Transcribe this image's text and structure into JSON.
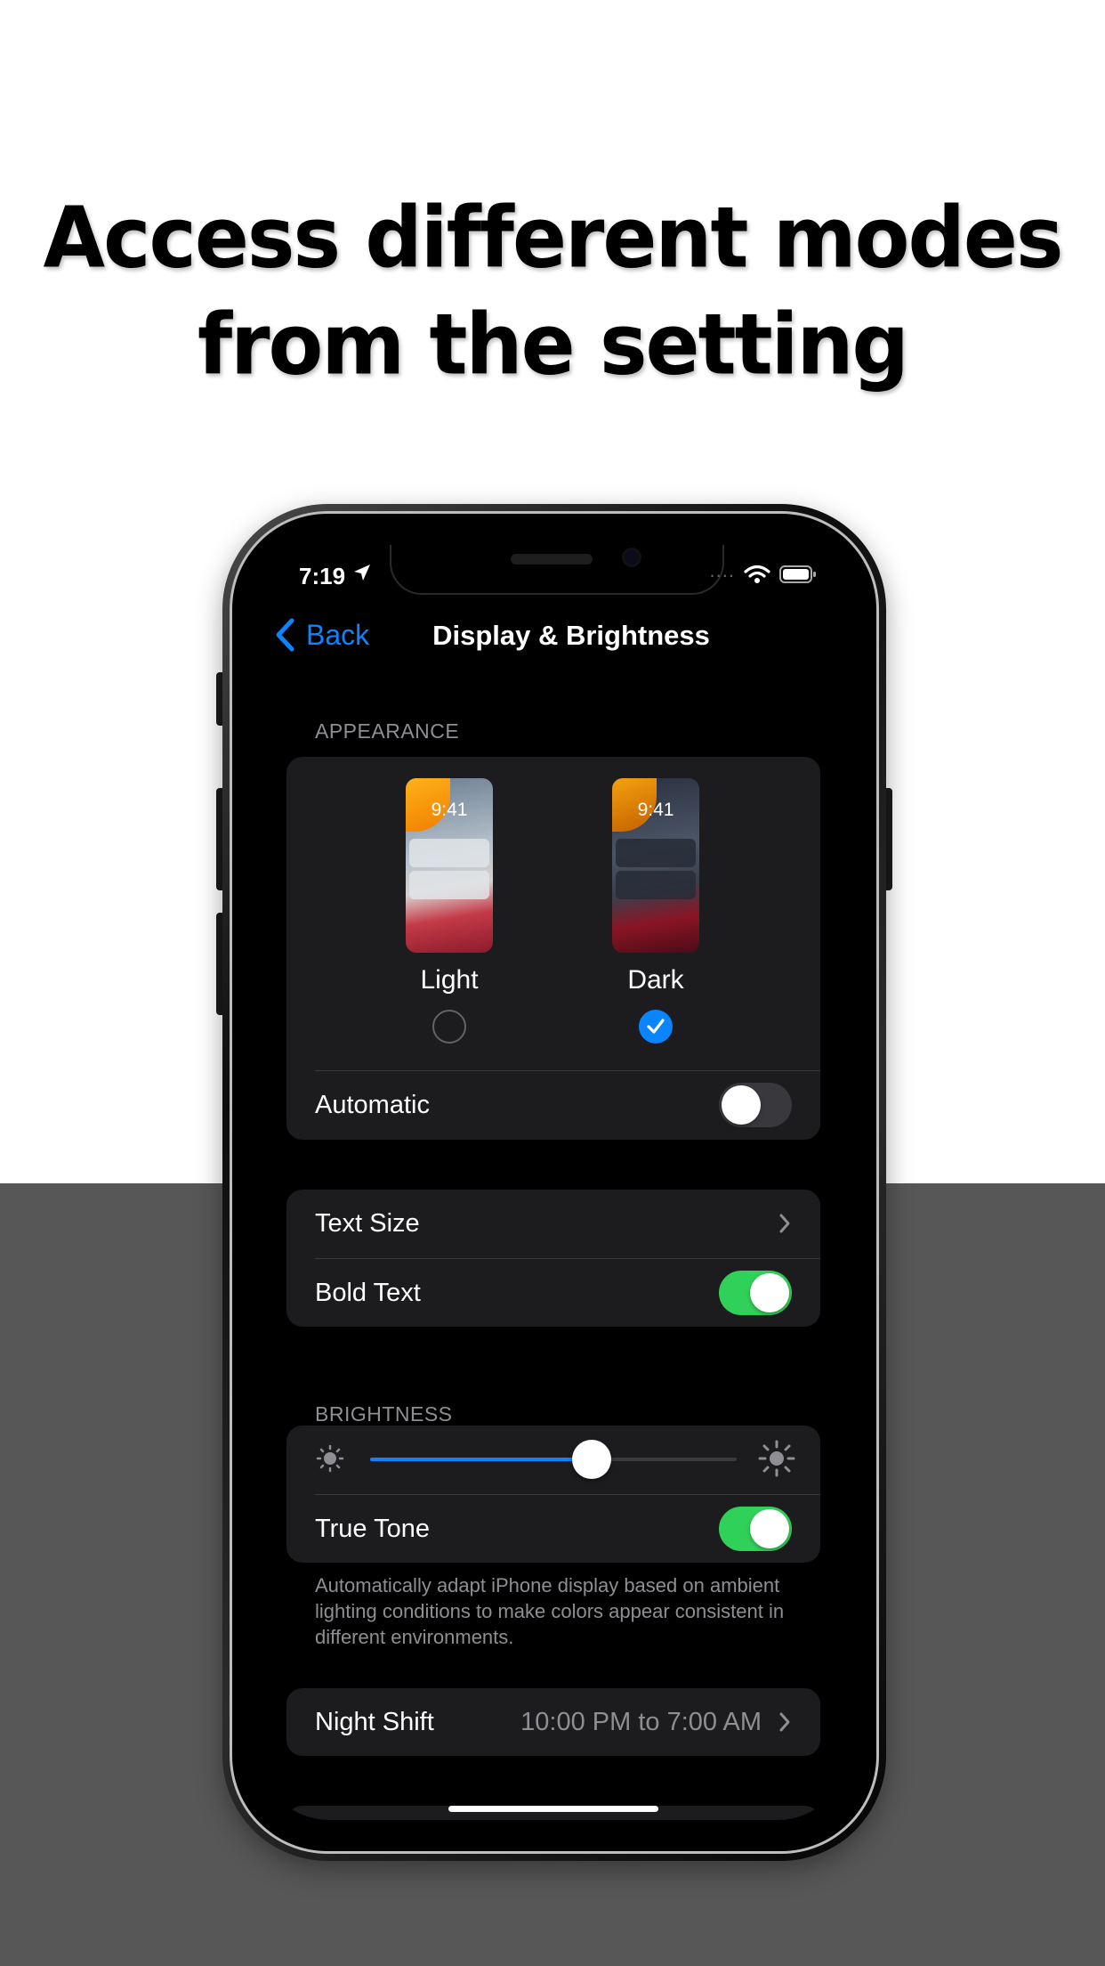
{
  "headline": {
    "line1": "Access different modes",
    "line2": "from the setting"
  },
  "status_bar": {
    "time": "7:19",
    "signal_text": "....",
    "icons": [
      "location-arrow-icon",
      "wifi-icon",
      "battery-icon"
    ]
  },
  "nav": {
    "back_label": "Back",
    "title": "Display & Brightness"
  },
  "appearance": {
    "header": "APPEARANCE",
    "modes": [
      {
        "label": "Light",
        "preview_time": "9:41",
        "selected": false
      },
      {
        "label": "Dark",
        "preview_time": "9:41",
        "selected": true
      }
    ],
    "automatic": {
      "label": "Automatic",
      "on": false
    }
  },
  "text_group": {
    "text_size_label": "Text Size",
    "bold_text": {
      "label": "Bold Text",
      "on": true
    }
  },
  "brightness": {
    "header": "BRIGHTNESS",
    "level": 0.605,
    "true_tone": {
      "label": "True Tone",
      "on": true
    },
    "footer": "Automatically adapt iPhone display based on ambient lighting conditions to make colors appear consistent in different environments."
  },
  "night_shift": {
    "label": "Night Shift",
    "value": "10:00 PM to 7:00 AM"
  },
  "colors": {
    "accent": "#0a84ff",
    "toggle_on": "#30d158",
    "cell_bg": "#1c1c1e",
    "secondary_text": "#8e8e93"
  }
}
